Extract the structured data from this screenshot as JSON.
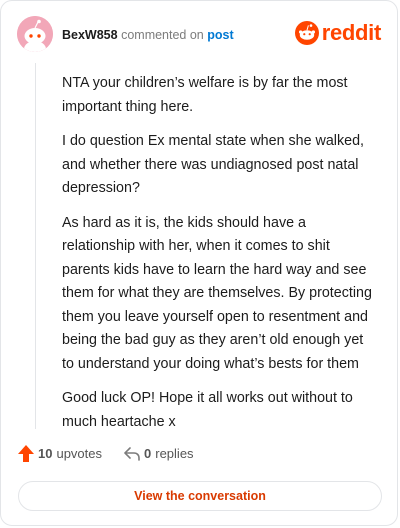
{
  "header": {
    "username": "BexW858",
    "verb": "commented on",
    "target": "post",
    "brand": "reddit"
  },
  "comment": {
    "paragraphs": [
      "NTA your children’s welfare is by far the most important thing here.",
      "I do question Ex mental state when she walked, and whether there was undiagnosed post natal depression?",
      "As hard as it is, the kids should have a relationship with her, when it comes to shit parents kids have to learn the hard way and see them for what they are themselves. By protecting them you leave yourself open to resentment and being the bad guy as they aren’t old enough yet to understand your doing what’s bests for them",
      "Good luck OP! Hope it all works out without to much heartache x"
    ]
  },
  "meta": {
    "upvotes_count": "10",
    "upvotes_word": "upvotes",
    "replies_count": "0",
    "replies_word": "replies"
  },
  "cta": {
    "label": "View the conversation"
  },
  "colors": {
    "brand": "#ff4500",
    "link": "#0079d3",
    "cta": "#d93a00",
    "avatar_bg": "#f2a7b8"
  },
  "icons": [
    "snoo-avatar-icon",
    "reddit-logo-icon",
    "upvote-arrow-icon",
    "reply-arrow-icon"
  ]
}
